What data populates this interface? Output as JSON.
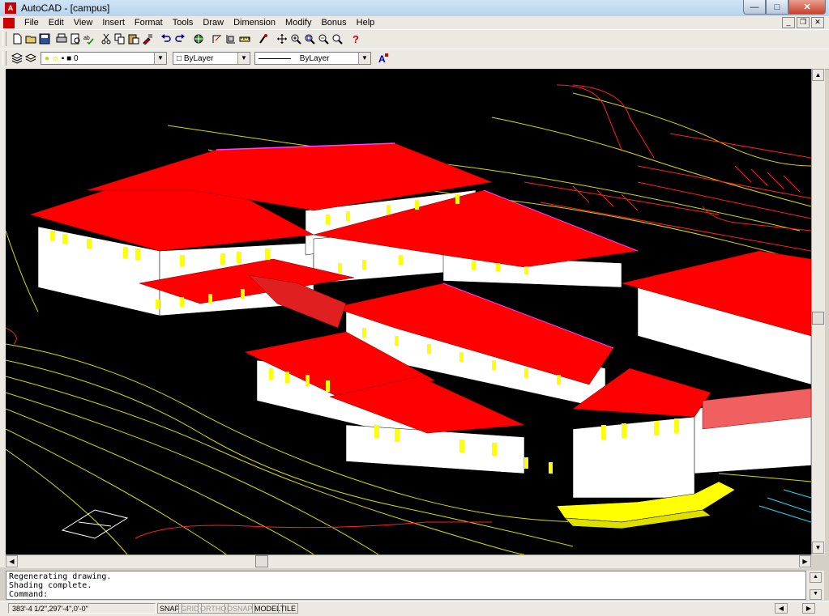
{
  "window": {
    "title": "AutoCAD - [campus]",
    "minimize": "—",
    "maximize": "□",
    "close": "✕"
  },
  "menu": [
    "File",
    "Edit",
    "View",
    "Insert",
    "Format",
    "Tools",
    "Draw",
    "Dimension",
    "Modify",
    "Bonus",
    "Help"
  ],
  "layer": {
    "current": "0"
  },
  "color": {
    "current": "ByLayer"
  },
  "linetype": {
    "current": "ByLayer"
  },
  "command_history": [
    "Regenerating drawing.",
    "Shading complete."
  ],
  "command_prompt": "Command:",
  "status": {
    "coordinates": "383'-4 1/2\",297'-4\",0'-0\"",
    "toggles": [
      {
        "label": "SNAP",
        "on": true
      },
      {
        "label": "GRID",
        "on": false
      },
      {
        "label": "ORTHO",
        "on": false
      },
      {
        "label": "OSNAP",
        "on": false
      },
      {
        "label": "MODEL",
        "on": true
      },
      {
        "label": "TILE",
        "on": true
      }
    ]
  },
  "colors": {
    "canvas": "#000000",
    "roof": "#ff0000",
    "window": "#ffff00",
    "contour": "#d9d900",
    "wall": "#ffffff"
  },
  "icons": [
    "new-icon",
    "open-icon",
    "save-icon",
    "print-icon",
    "preview-icon",
    "spell-icon",
    "cut-icon",
    "copy-icon",
    "paste-icon",
    "matchprop-icon",
    "undo-icon",
    "redo-icon",
    "hyperlink-icon",
    "tracking-icon",
    "ucs-icon",
    "distance-icon",
    "pan-icon",
    "zoom-realtime-icon",
    "zoom-window-icon",
    "zoom-previous-icon",
    "help-icon"
  ]
}
